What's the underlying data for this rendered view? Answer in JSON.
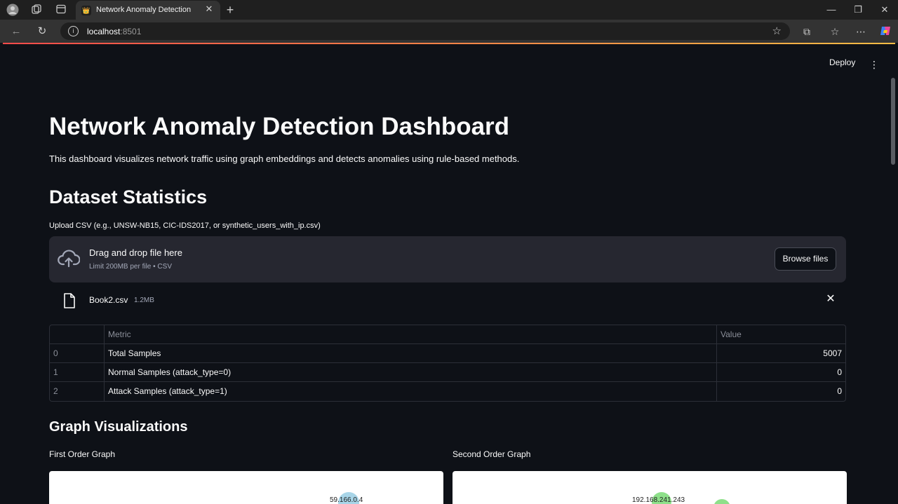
{
  "browser": {
    "tab_title": "Network Anomaly Detection",
    "url_host": "localhost",
    "url_port": ":8501"
  },
  "toolbar": {
    "deploy_label": "Deploy"
  },
  "page": {
    "title": "Network Anomaly Detection Dashboard",
    "description": "This dashboard visualizes network traffic using graph embeddings and detects anomalies using rule-based methods.",
    "section_dataset": "Dataset Statistics",
    "upload_label": "Upload CSV (e.g., UNSW-NB15, CIC-IDS2017, or synthetic_users_with_ip.csv)"
  },
  "uploader": {
    "drop_title": "Drag and drop file here",
    "drop_limit": "Limit 200MB per file • CSV",
    "browse_label": "Browse files",
    "file_name": "Book2.csv",
    "file_size": "1.2MB"
  },
  "stats_table": {
    "headers": [
      "",
      "Metric",
      "Value"
    ],
    "rows": [
      {
        "index": "0",
        "metric": "Total Samples",
        "value": "5007"
      },
      {
        "index": "1",
        "metric": "Normal Samples (attack_type=0)",
        "value": "0"
      },
      {
        "index": "2",
        "metric": "Attack Samples (attack_type=1)",
        "value": "0"
      }
    ]
  },
  "graphs": {
    "section_title": "Graph Visualizations",
    "first_title": "First Order Graph",
    "second_title": "Second Order Graph",
    "first_node_label": "59.166.0.4",
    "second_node_label": "192.168.241.243",
    "first_node_color": "#a8d5e8",
    "second_node_color": "#8ee08a"
  }
}
